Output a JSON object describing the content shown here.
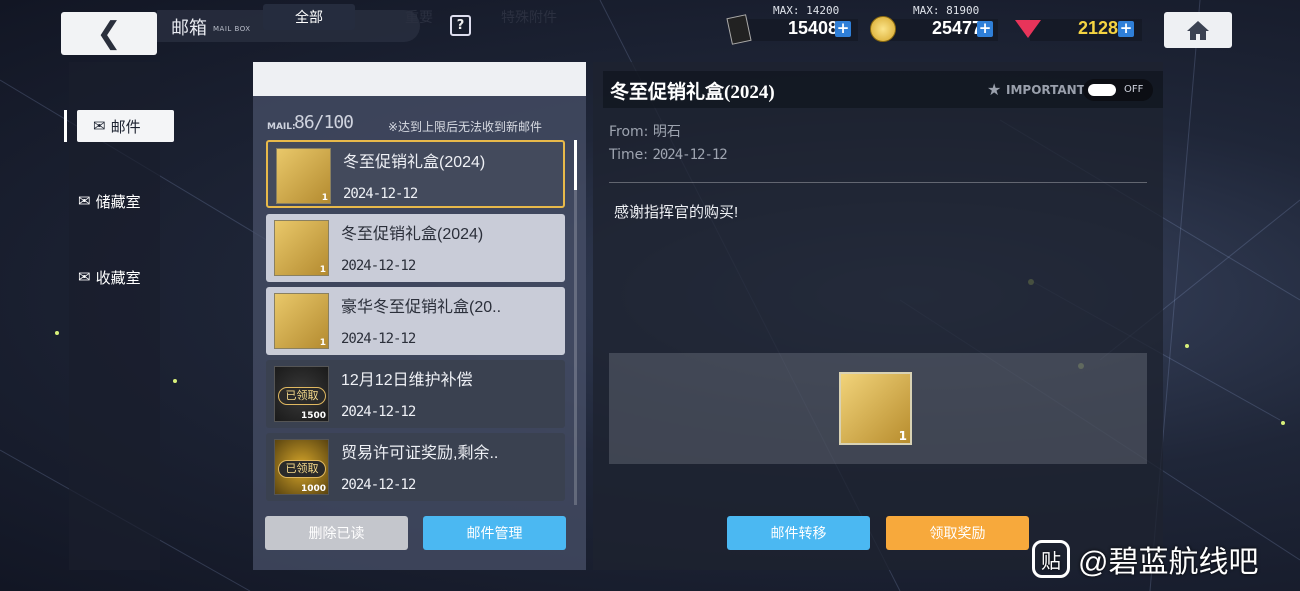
{
  "header": {
    "title": "邮箱",
    "subtitle": "MAIL BOX",
    "help": "?"
  },
  "resources": [
    {
      "name": "oil",
      "icon": "oil-icon",
      "max": "MAX: 14200",
      "value": "15408",
      "color": "#ffffff"
    },
    {
      "name": "gold",
      "icon": "coin-icon",
      "max": "MAX: 81900",
      "value": "25477",
      "color": "#ffffff"
    },
    {
      "name": "gems",
      "icon": "gem-icon",
      "max": "",
      "value": "2128",
      "color": "#f5d442"
    }
  ],
  "nav": {
    "items": [
      {
        "label": "邮件"
      },
      {
        "label": "储藏室"
      },
      {
        "label": "收藏室"
      }
    ]
  },
  "tabs": [
    {
      "label": "全部"
    },
    {
      "label": "重要"
    },
    {
      "label": "特殊附件"
    }
  ],
  "list": {
    "count_label": "MAIL:",
    "count": "86/100",
    "note": "※达到上限后无法收到新邮件",
    "mails": [
      {
        "subject": "冬至促销礼盒(2024)",
        "date": "2024-12-12",
        "count": "1",
        "state": "selected"
      },
      {
        "subject": "冬至促销礼盒(2024)",
        "date": "2024-12-12",
        "count": "1",
        "state": "unread"
      },
      {
        "subject": "豪华冬至促销礼盒(20..",
        "date": "2024-12-12",
        "count": "1",
        "state": "unread"
      },
      {
        "subject": "12月12日维护补偿",
        "date": "2024-12-12",
        "count": "1500",
        "state": "claimed",
        "badge": "已领取"
      },
      {
        "subject": "贸易许可证奖励,剩余..",
        "date": "2024-12-12",
        "count": "1000",
        "state": "claimed",
        "badge": "已领取"
      }
    ],
    "delete_read": "删除已读",
    "manage": "邮件管理"
  },
  "detail": {
    "title": "冬至促销礼盒(2024)",
    "important": "IMPORTANT",
    "toggle": "OFF",
    "from_label": "From:",
    "from": "明石",
    "time_label": "Time:",
    "time": "2024-12-12",
    "body": "感谢指挥官的购买!",
    "reward_count": "1",
    "transfer": "邮件转移",
    "claim": "领取奖励"
  },
  "watermark": {
    "icon": "贴",
    "text": "@碧蓝航线吧"
  },
  "colors": {
    "accent_blue": "#4bb8f2",
    "accent_orange": "#f7a93c",
    "selected_border": "#e8b94a"
  }
}
